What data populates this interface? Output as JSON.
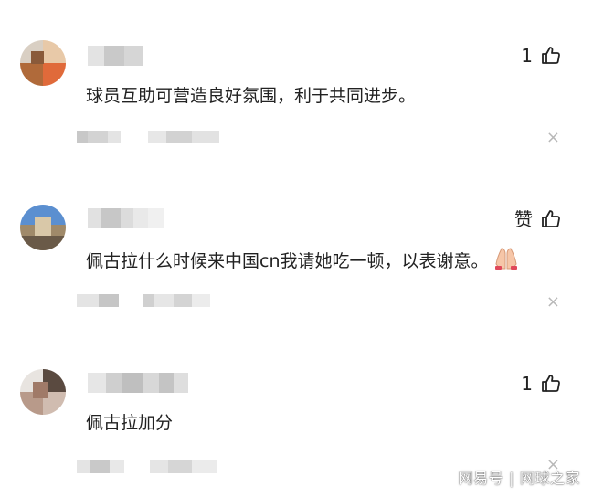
{
  "comments": [
    {
      "text": "球员互助可营造良好氛围，利于共同进步。",
      "like_count": "1",
      "close_glyph": "×"
    },
    {
      "text": "佩古拉什么时候来中国cn我请她吃一顿，以表谢意。",
      "like_count": "赞",
      "close_glyph": "×"
    },
    {
      "text": "佩古拉加分",
      "like_count": "1",
      "close_glyph": "×"
    }
  ],
  "watermark": {
    "source": "网易号",
    "separator": "|",
    "account": "网球之家"
  },
  "icons": {
    "like": "thumbs-up-icon",
    "close": "close-icon",
    "emoji": "folded-hands-emoji"
  },
  "colors": {
    "text": "#222222",
    "close": "#b8b8b8",
    "background": "#ffffff"
  }
}
